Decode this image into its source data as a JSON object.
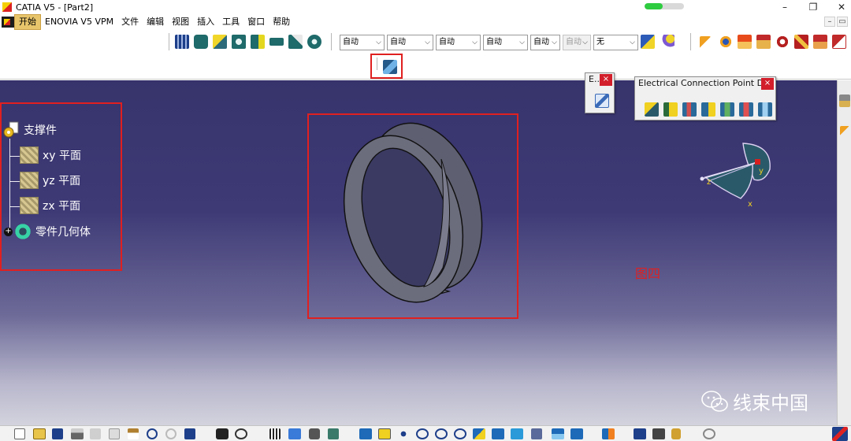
{
  "window": {
    "title": "CATIA V5 - [Part2]",
    "progress": 0.45,
    "controls": {
      "minimize": "–",
      "restore": "❐",
      "close": "✕"
    }
  },
  "menu": {
    "items": [
      "开始",
      "ENOVIA V5 VPM",
      "文件",
      "编辑",
      "视图",
      "插入",
      "工具",
      "窗口",
      "帮助"
    ],
    "active_index": 0,
    "mdi_controls": {
      "minimize": "–",
      "restore": "▭"
    }
  },
  "toolbar": {
    "combos": [
      {
        "value": "自动",
        "enabled": true
      },
      {
        "value": "自动",
        "enabled": true
      },
      {
        "value": "自动",
        "enabled": true
      },
      {
        "value": "自动",
        "enabled": true
      },
      {
        "value": "自动",
        "enabled": true
      },
      {
        "value": "自动",
        "enabled": false
      },
      {
        "value": "无",
        "enabled": true
      }
    ]
  },
  "tree": {
    "root": "支撑件",
    "children": [
      "xy 平面",
      "yz 平面",
      "zx 平面"
    ],
    "body": "零件几何体"
  },
  "floating_toolbars": [
    {
      "title": "E...",
      "close": "×"
    },
    {
      "title": "Electrical Connection Point De...",
      "close": "×"
    }
  ],
  "compass": {
    "x": "x",
    "y": "y",
    "z": "z"
  },
  "figure_label": "图四",
  "watermark": "线束中国",
  "colors": {
    "highlight": "#e02020",
    "viewport_top": "#37336b",
    "viewport_bottom": "#d3d3de",
    "ring_fill": "#6b6c7c"
  }
}
